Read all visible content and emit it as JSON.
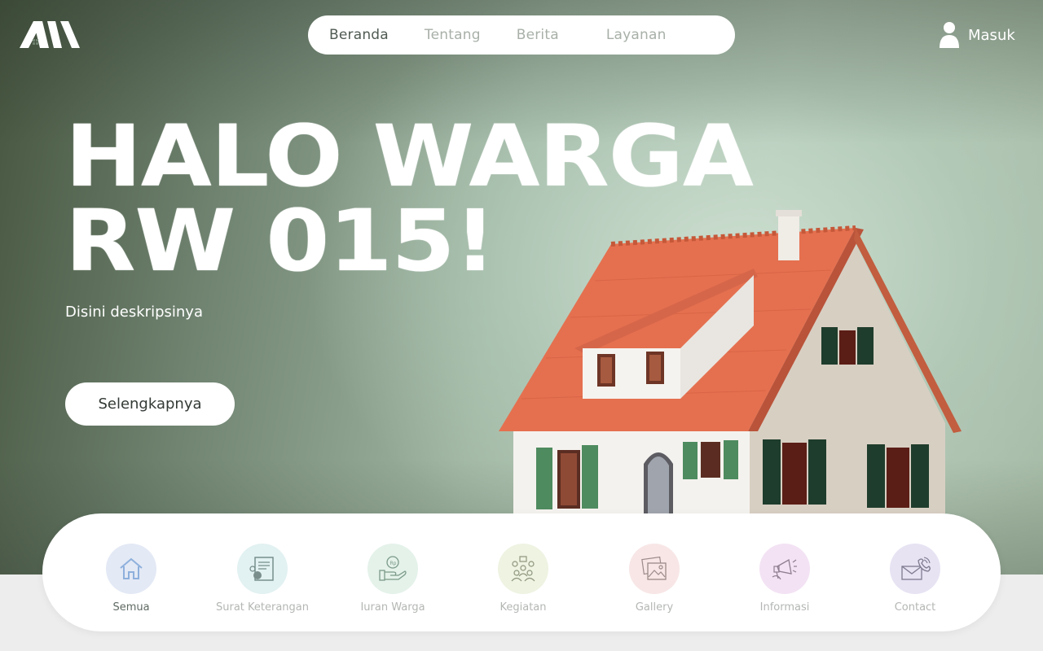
{
  "nav": {
    "items": [
      {
        "label": "Beranda",
        "active": true
      },
      {
        "label": "Tentang",
        "active": false
      },
      {
        "label": "Berita",
        "active": false
      },
      {
        "label": "Layanan",
        "active": false
      }
    ],
    "login_label": "Masuk"
  },
  "hero": {
    "title_line1": "HALO WARGA",
    "title_line2": "RW 015!",
    "description": "Disini deskripsinya",
    "cta_label": "Selengkapnya"
  },
  "categories": [
    {
      "label": "Semua",
      "icon": "home-icon",
      "color": "#e3e9f5",
      "active": true
    },
    {
      "label": "Surat Keterangan",
      "icon": "document-icon",
      "color": "#e2f1f1",
      "active": false
    },
    {
      "label": "Iuran Warga",
      "icon": "payment-hand-icon",
      "color": "#e4f2ea",
      "active": false
    },
    {
      "label": "Kegiatan",
      "icon": "community-icon",
      "color": "#eef3e2",
      "active": false
    },
    {
      "label": "Gallery",
      "icon": "gallery-icon",
      "color": "#f8e6e6",
      "active": false
    },
    {
      "label": "Informasi",
      "icon": "megaphone-icon",
      "color": "#f3e2f4",
      "active": false
    },
    {
      "label": "Contact",
      "icon": "contact-icon",
      "color": "#e7e3f3",
      "active": false
    }
  ]
}
